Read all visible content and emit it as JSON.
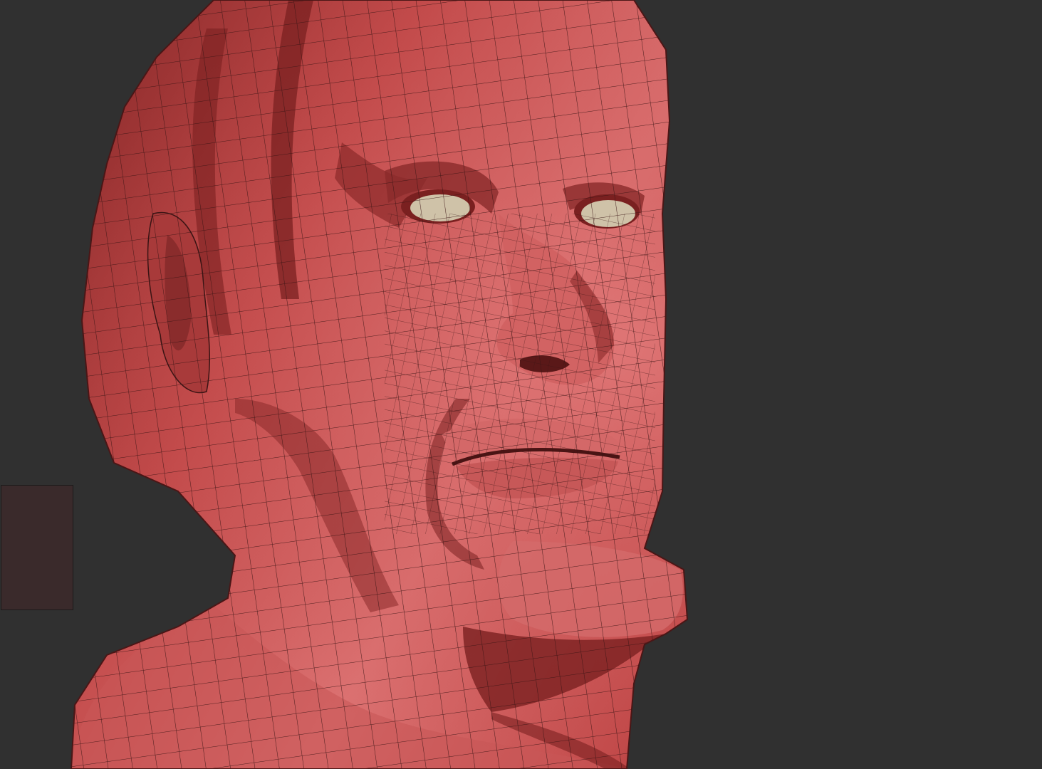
{
  "viewport": {
    "background_color": "#303030"
  },
  "model": {
    "subject": "sculpted-head-wireframe",
    "skin_color": "#c24a4a",
    "skin_light_color": "#dc7272",
    "skin_dark_color": "#7a2020",
    "wire_color": "#3a1414",
    "eye_color": "#cfc2a8"
  },
  "side_swatch": {
    "color": "#3a2a2b"
  }
}
